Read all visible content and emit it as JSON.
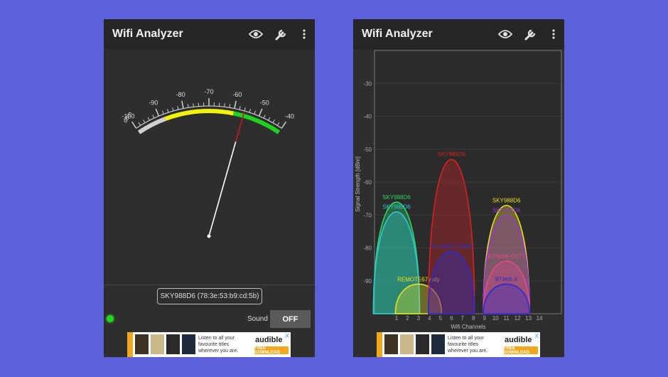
{
  "left_phone": {
    "app_title": "Wifi Analyzer",
    "icons": [
      "eye-icon",
      "wrench-icon",
      "more-vert-icon"
    ],
    "meter": {
      "unit": "dBm",
      "scale_labels": [
        "-100",
        "-90",
        "-80",
        "-70",
        "-60",
        "-50",
        "-40"
      ],
      "needle_value": -56,
      "band_colors": {
        "low": "#d0d0d0",
        "mid": "#f2f20a",
        "high": "#1ed31e",
        "needle_tip": "#c21b1b",
        "needle": "#ffffff"
      }
    },
    "selected_network": "SKY988D6 (78:3e:53:b9:cd:5b)",
    "sound_label": "Sound",
    "sound_toggle": "OFF",
    "ad": {
      "line1": "Listen to all your",
      "line2": "favourite titles",
      "line3": "wherever you are.",
      "brand": "audible",
      "cta": "FREE DOWNLOAD",
      "close": "X"
    }
  },
  "right_phone": {
    "app_title": "Wifi Analyzer",
    "icons": [
      "eye-icon",
      "wrench-icon",
      "more-vert-icon"
    ],
    "ad": {
      "line1": "Listen to all your",
      "line2": "favourite titles",
      "line3": "wherever you are.",
      "brand": "audible",
      "cta": "FREE DOWNLOAD",
      "close": "X"
    },
    "chart_data": {
      "type": "area",
      "ylabel": "Signal Strength [dBm]",
      "xlabel": "Wifi Channels",
      "y_ticks": [
        "-30",
        "-40",
        "-50",
        "-60",
        "-70",
        "-80",
        "-90"
      ],
      "x_ticks": [
        "1",
        "2",
        "3",
        "4",
        "5",
        "6",
        "7",
        "8",
        "9",
        "10",
        "11",
        "12",
        "13",
        "14"
      ],
      "ylim": [
        -100,
        -20
      ],
      "xlim": [
        -1,
        16
      ],
      "grid": true,
      "series": [
        {
          "name": "SKY988D6",
          "channel": 1,
          "peak": -66,
          "color": "#2ed36a"
        },
        {
          "name": "SKY988D6",
          "channel": 1,
          "peak": -69,
          "color": "#2ec7d6"
        },
        {
          "name": "REMOTE67ysdy",
          "channel": 3,
          "peak": -91,
          "color": "#e6e020"
        },
        {
          "name": "SKY988D6",
          "channel": 6,
          "peak": -53,
          "color": "#d42222"
        },
        {
          "name": "PLUSNET-JR4G",
          "channel": 6,
          "peak": -81,
          "color": "#2a2ad6"
        },
        {
          "name": "SKY988D6",
          "channel": 11,
          "peak": -67,
          "color": "#e6e020"
        },
        {
          "name": "SKY988D6",
          "channel": 11,
          "peak": -70,
          "color": "#9b35d9"
        },
        {
          "name": "BTHub6-G5T7",
          "channel": 11,
          "peak": -84,
          "color": "#e24a8f"
        },
        {
          "name": "BTWifi-X",
          "channel": 11,
          "peak": -91,
          "color": "#2a2ad6"
        }
      ]
    }
  }
}
